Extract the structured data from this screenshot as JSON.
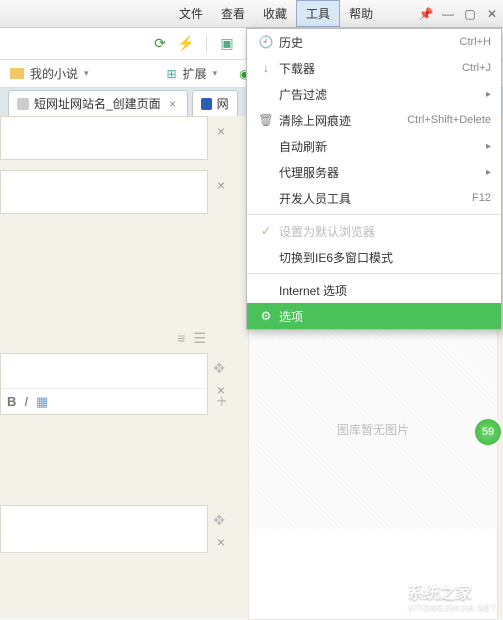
{
  "menubar": {
    "items": [
      "文件",
      "查看",
      "收藏",
      "工具",
      "帮助"
    ],
    "active_index": 3
  },
  "bookmarks": {
    "folder": "我的小说",
    "ext_label": "扩展"
  },
  "tabs": [
    {
      "title": "短网址网站名_创建页面"
    },
    {
      "title": "网"
    }
  ],
  "dropdown": {
    "items": [
      {
        "icon": "clock",
        "label": "历史",
        "shortcut": "Ctrl+H"
      },
      {
        "icon": "down",
        "label": "下载器",
        "shortcut": "Ctrl+J"
      },
      {
        "label": "广告过滤",
        "submenu": true
      },
      {
        "icon": "trash",
        "label": "清除上网痕迹",
        "shortcut": "Ctrl+Shift+Delete"
      },
      {
        "label": "自动刷新",
        "submenu": true
      },
      {
        "label": "代理服务器",
        "submenu": true
      },
      {
        "label": "开发人员工具",
        "shortcut": "F12"
      },
      {
        "sep": true
      },
      {
        "icon": "check",
        "label": "设置为默认浏览器",
        "disabled": true
      },
      {
        "label": "切换到IE6多窗口模式"
      },
      {
        "sep": true
      },
      {
        "label": "Internet 选项"
      },
      {
        "icon": "gear",
        "label": "选项",
        "selected": true
      }
    ]
  },
  "gallery": {
    "placeholder": "图库暂无图片"
  },
  "score": "59",
  "watermark": {
    "name": "系统之家",
    "url": "XITONGZHIJIA.NET"
  }
}
